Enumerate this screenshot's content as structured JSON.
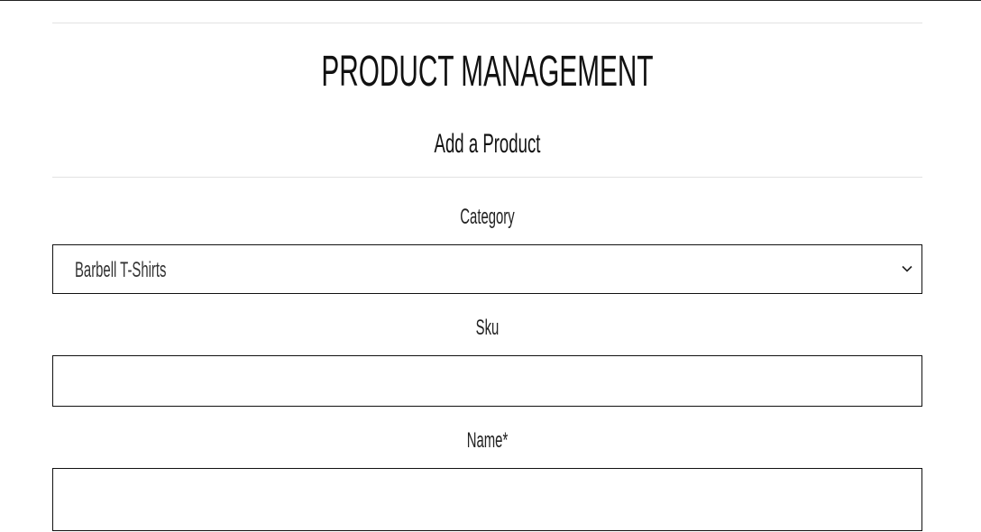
{
  "header": {
    "title": "PRODUCT MANAGEMENT",
    "subtitle": "Add a Product"
  },
  "form": {
    "category": {
      "label": "Category",
      "selected": "Barbell T-Shirts",
      "icon": "chevron-down-icon"
    },
    "sku": {
      "label": "Sku",
      "value": ""
    },
    "name": {
      "label": "Name*",
      "value": ""
    }
  }
}
